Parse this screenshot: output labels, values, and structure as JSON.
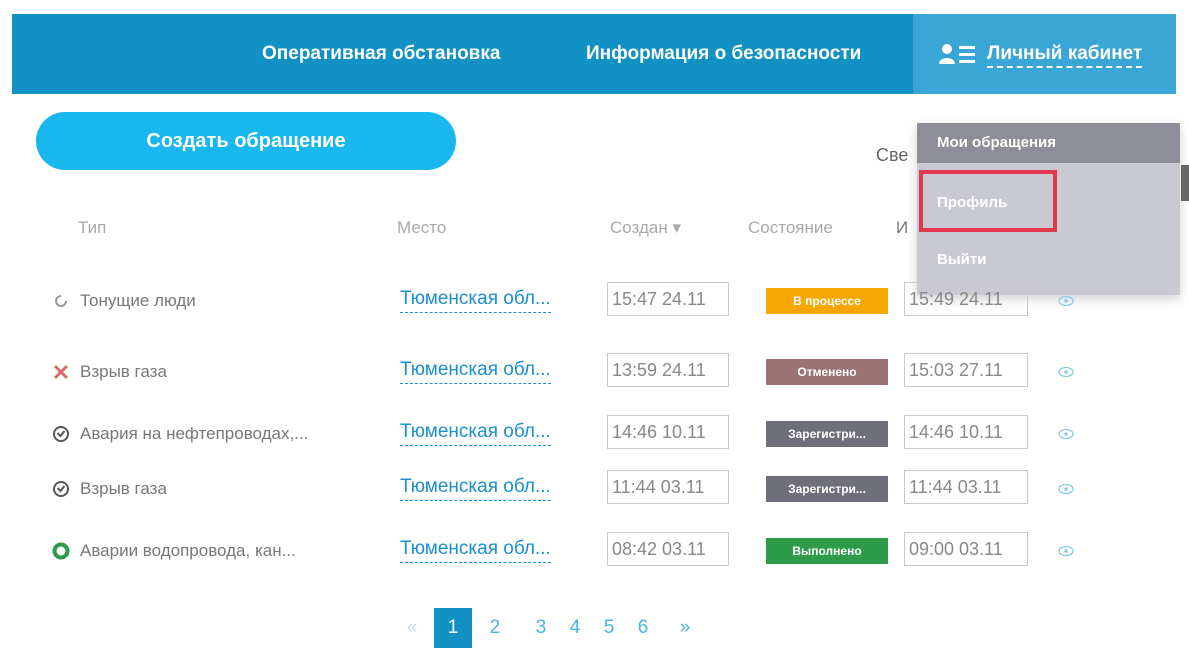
{
  "nav": {
    "ops": "Оперативная обстановка",
    "info": "Информация о безопасности",
    "cabinet": "Личный кабинет"
  },
  "dropdown": {
    "header": "Мои обращения",
    "profile": "Профиль",
    "logout": "Выйти"
  },
  "create_button": "Создать обращение",
  "partial_text": "Све",
  "table": {
    "headers": {
      "type": "Тип",
      "place": "Место",
      "created": "Создан ▾",
      "state": "Состояние",
      "changed": "И"
    },
    "rows": [
      {
        "icon": "spinner-icon",
        "type": "Тонущие люди",
        "place": "Тюменская обл...",
        "created": "15:47 24.11",
        "state": "В процессе",
        "state_color": "#f6a600",
        "changed": "15:49 24.11"
      },
      {
        "icon": "cross-icon",
        "type": "Взрыв газа",
        "place": "Тюменская обл...",
        "created": "13:59 24.11",
        "state": "Отменено",
        "state_color": "#9a7373",
        "changed": "15:03 27.11"
      },
      {
        "icon": "check-circle-icon",
        "type": "Авария на нефтепроводах,...",
        "place": "Тюменская обл...",
        "created": "14:46 10.11",
        "state": "Зарегистри...",
        "state_color": "#6f6f7c",
        "changed": "14:46 10.11"
      },
      {
        "icon": "check-circle-icon",
        "type": "Взрыв газа",
        "place": "Тюменская обл...",
        "created": "11:44 03.11",
        "state": "Зарегистри...",
        "state_color": "#6f6f7c",
        "changed": "11:44 03.11"
      },
      {
        "icon": "green-circle-icon",
        "type": "Аварии водопровода, кан...",
        "place": "Тюменская обл...",
        "created": "08:42 03.11",
        "state": "Выполнено",
        "state_color": "#2d9b49",
        "changed": "09:00 03.11"
      }
    ]
  },
  "pagination": {
    "prev": "«",
    "pages": [
      "1",
      "2",
      "3",
      "4",
      "5",
      "6"
    ],
    "current": "1",
    "next": "»"
  },
  "colors": {
    "topbar": "#1191c4",
    "accent": "#18b7ee",
    "highlight": "#e2384f"
  }
}
